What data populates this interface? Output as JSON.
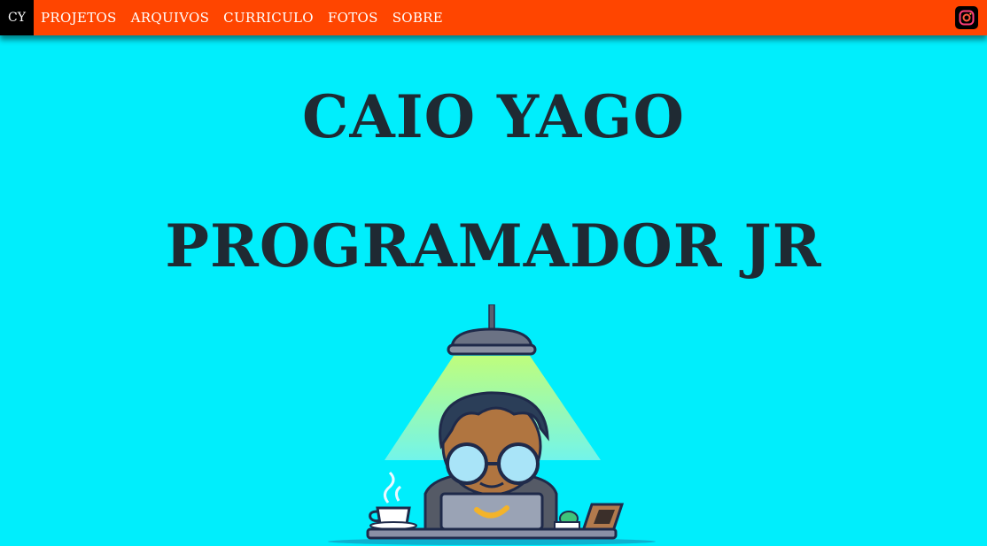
{
  "nav": {
    "logo": "CY",
    "items": [
      "PROJETOS",
      "ARQUIVOS",
      "CURRICULO",
      "FOTOS",
      "SOBRE"
    ],
    "social_icon": "instagram-icon",
    "background": "#ff4500"
  },
  "hero": {
    "name": "CAIO YAGO",
    "role": "PROGRAMADOR JR"
  },
  "illustration": "programmer-at-laptop-under-lamp",
  "colors": {
    "page_background": "#00eefc",
    "title_text": "#1f2a33"
  }
}
